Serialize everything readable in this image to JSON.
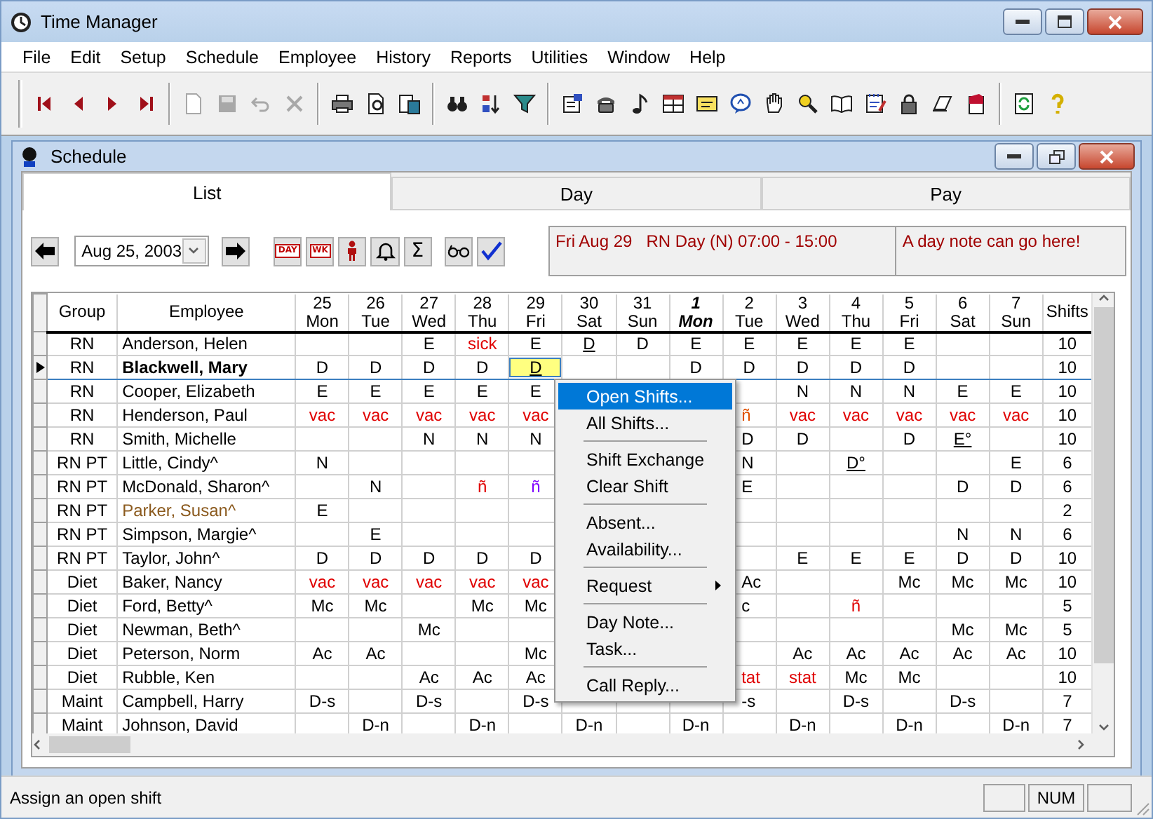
{
  "window": {
    "title": "Time Manager"
  },
  "menu": [
    "File",
    "Edit",
    "Setup",
    "Schedule",
    "Employee",
    "History",
    "Reports",
    "Utilities",
    "Window",
    "Help"
  ],
  "toolbar": [
    [
      {
        "disabled": false
      },
      {
        "disabled": false
      },
      {
        "disabled": false
      },
      {
        "disabled": false
      }
    ],
    [
      {
        "disabled": true
      },
      {
        "disabled": true
      },
      {
        "disabled": true
      },
      {
        "disabled": true
      }
    ],
    [
      {
        "disabled": false
      },
      {
        "disabled": false
      },
      {
        "disabled": false
      }
    ],
    [
      {
        "disabled": false
      },
      {
        "disabled": false
      },
      {
        "disabled": false
      }
    ],
    [
      {
        "disabled": false
      },
      {
        "disabled": false
      },
      {
        "disabled": false
      },
      {
        "disabled": false
      },
      {
        "disabled": false
      },
      {
        "disabled": false
      },
      {
        "disabled": false
      },
      {
        "disabled": false
      },
      {
        "disabled": false
      },
      {
        "disabled": false
      },
      {
        "disabled": false
      },
      {
        "disabled": false
      },
      {
        "disabled": false
      }
    ],
    [
      {
        "disabled": false
      },
      {
        "disabled": false
      }
    ]
  ],
  "schedule": {
    "title": "Schedule",
    "tabs": [
      {
        "label": "List",
        "selected": true
      },
      {
        "label": "Day",
        "selected": false
      },
      {
        "label": "Pay",
        "selected": false
      }
    ],
    "date": "Aug 25, 2003",
    "day_label": "DAY",
    "week_label": "WK",
    "sum_label": "Σ",
    "shift_info": "Fri Aug 29   RN Day (N) 07:00 - 15:00",
    "day_note": "A day note can go here!",
    "columns": {
      "group": "Group",
      "employee": "Employee",
      "shifts": "Shifts",
      "days": [
        {
          "date": "25",
          "weekday": "Mon",
          "emphasized": false
        },
        {
          "date": "26",
          "weekday": "Tue",
          "emphasized": false
        },
        {
          "date": "27",
          "weekday": "Wed",
          "emphasized": false
        },
        {
          "date": "28",
          "weekday": "Thu",
          "emphasized": false
        },
        {
          "date": "29",
          "weekday": "Fri",
          "emphasized": false
        },
        {
          "date": "30",
          "weekday": "Sat",
          "emphasized": false
        },
        {
          "date": "31",
          "weekday": "Sun",
          "emphasized": false
        },
        {
          "date": "1",
          "weekday": "Mon",
          "emphasized": true
        },
        {
          "date": "2",
          "weekday": "Tue",
          "emphasized": false
        },
        {
          "date": "3",
          "weekday": "Wed",
          "emphasized": false
        },
        {
          "date": "4",
          "weekday": "Thu",
          "emphasized": false
        },
        {
          "date": "5",
          "weekday": "Fri",
          "emphasized": false
        },
        {
          "date": "6",
          "weekday": "Sat",
          "emphasized": false
        },
        {
          "date": "7",
          "weekday": "Sun",
          "emphasized": false
        }
      ]
    },
    "rows": [
      {
        "group": "RN",
        "name": "Anderson, Helen",
        "color": "#000000",
        "selected": false,
        "shifts": "10",
        "days": [
          {
            "kind": "blank"
          },
          {
            "kind": "blank"
          },
          {
            "kind": "shift",
            "text": "E"
          },
          {
            "kind": "shift",
            "text": "sick",
            "color": "#e00000"
          },
          {
            "kind": "shift",
            "text": "E"
          },
          {
            "kind": "shift",
            "text": "D",
            "underlined": true
          },
          {
            "kind": "shift",
            "text": "D"
          },
          {
            "kind": "shift",
            "text": "E"
          },
          {
            "kind": "shift",
            "text": "E"
          },
          {
            "kind": "shift",
            "text": "E"
          },
          {
            "kind": "shift",
            "text": "E"
          },
          {
            "kind": "shift",
            "text": "E"
          },
          {
            "kind": "blank"
          },
          {
            "kind": "blank"
          }
        ]
      },
      {
        "group": "RN",
        "name": "Blackwell, Mary",
        "color": "#000000",
        "selected": true,
        "shifts": "10",
        "days": [
          {
            "kind": "shift",
            "text": "D"
          },
          {
            "kind": "shift",
            "text": "D"
          },
          {
            "kind": "shift",
            "text": "D"
          },
          {
            "kind": "shift",
            "text": "D"
          },
          {
            "kind": "shift",
            "text": "D",
            "underlined": true,
            "focused": true
          },
          {
            "kind": "blank"
          },
          {
            "kind": "blank"
          },
          {
            "kind": "shift",
            "text": "D"
          },
          {
            "kind": "shift",
            "text": "D"
          },
          {
            "kind": "shift",
            "text": "D"
          },
          {
            "kind": "shift",
            "text": "D"
          },
          {
            "kind": "shift",
            "text": "D"
          },
          {
            "kind": "blank"
          },
          {
            "kind": "blank"
          }
        ]
      },
      {
        "group": "RN",
        "name": "Cooper, Elizabeth",
        "color": "#000000",
        "selected": false,
        "shifts": "10",
        "days": [
          {
            "kind": "shift",
            "text": "E"
          },
          {
            "kind": "shift",
            "text": "E"
          },
          {
            "kind": "shift",
            "text": "E"
          },
          {
            "kind": "shift",
            "text": "E"
          },
          {
            "kind": "shift",
            "text": "E"
          },
          {
            "kind": "blank"
          },
          {
            "kind": "blank"
          },
          {
            "kind": "blank"
          },
          {
            "kind": "blank"
          },
          {
            "kind": "shift",
            "text": "N"
          },
          {
            "kind": "shift",
            "text": "N"
          },
          {
            "kind": "shift",
            "text": "N"
          },
          {
            "kind": "shift",
            "text": "E"
          },
          {
            "kind": "shift",
            "text": "E"
          }
        ]
      },
      {
        "group": "RN",
        "name": "Henderson, Paul",
        "color": "#000000",
        "selected": false,
        "shifts": "10",
        "days": [
          {
            "kind": "shift",
            "text": "vac",
            "color": "#e00000"
          },
          {
            "kind": "shift",
            "text": "vac",
            "color": "#e00000"
          },
          {
            "kind": "shift",
            "text": "vac",
            "color": "#e00000"
          },
          {
            "kind": "shift",
            "text": "vac",
            "color": "#e00000"
          },
          {
            "kind": "shift",
            "text": "vac",
            "color": "#e00000"
          },
          {
            "kind": "blank"
          },
          {
            "kind": "blank"
          },
          {
            "kind": "blank"
          },
          {
            "kind": "partial",
            "text": "ñ",
            "color": "#e05000"
          },
          {
            "kind": "shift",
            "text": "vac",
            "color": "#e00000"
          },
          {
            "kind": "shift",
            "text": "vac",
            "color": "#e00000"
          },
          {
            "kind": "shift",
            "text": "vac",
            "color": "#e00000"
          },
          {
            "kind": "shift",
            "text": "vac",
            "color": "#e00000"
          },
          {
            "kind": "shift",
            "text": "vac",
            "color": "#e00000"
          }
        ]
      },
      {
        "group": "RN",
        "name": "Smith, Michelle",
        "color": "#000000",
        "selected": false,
        "shifts": "10",
        "days": [
          {
            "kind": "blank"
          },
          {
            "kind": "blank"
          },
          {
            "kind": "shift",
            "text": "N"
          },
          {
            "kind": "shift",
            "text": "N"
          },
          {
            "kind": "shift",
            "text": "N"
          },
          {
            "kind": "blank"
          },
          {
            "kind": "blank"
          },
          {
            "kind": "blank"
          },
          {
            "kind": "partial",
            "text": "D"
          },
          {
            "kind": "shift",
            "text": "D"
          },
          {
            "kind": "blank"
          },
          {
            "kind": "shift",
            "text": "D"
          },
          {
            "kind": "shift",
            "text": "E°",
            "underlined": true
          },
          {
            "kind": "blank"
          }
        ]
      },
      {
        "group": "RN PT",
        "name": "Little, Cindy^",
        "color": "#000000",
        "selected": false,
        "shifts": "6",
        "days": [
          {
            "kind": "shift",
            "text": "N"
          },
          {
            "kind": "blank"
          },
          {
            "kind": "blank"
          },
          {
            "kind": "blank"
          },
          {
            "kind": "blank"
          },
          {
            "kind": "blank"
          },
          {
            "kind": "blank"
          },
          {
            "kind": "blank"
          },
          {
            "kind": "partial",
            "text": "N"
          },
          {
            "kind": "blank"
          },
          {
            "kind": "shift",
            "text": "D°",
            "underlined": true
          },
          {
            "kind": "blank"
          },
          {
            "kind": "blank"
          },
          {
            "kind": "shift",
            "text": "E"
          }
        ]
      },
      {
        "group": "RN PT",
        "name": "McDonald, Sharon^",
        "color": "#000000",
        "selected": false,
        "shifts": "6",
        "days": [
          {
            "kind": "blank"
          },
          {
            "kind": "shift",
            "text": "N"
          },
          {
            "kind": "blank"
          },
          {
            "kind": "shift",
            "text": "ñ",
            "color": "#e00000"
          },
          {
            "kind": "shift",
            "text": "ñ",
            "color": "#8000ff"
          },
          {
            "kind": "blank"
          },
          {
            "kind": "blank"
          },
          {
            "kind": "blank"
          },
          {
            "kind": "partial",
            "text": "E"
          },
          {
            "kind": "blank"
          },
          {
            "kind": "blank"
          },
          {
            "kind": "blank"
          },
          {
            "kind": "shift",
            "text": "D"
          },
          {
            "kind": "shift",
            "text": "D"
          }
        ]
      },
      {
        "group": "RN PT",
        "name": "Parker, Susan^",
        "color": "#8b5a1e",
        "selected": false,
        "shifts": "2",
        "days": [
          {
            "kind": "shift",
            "text": "E"
          },
          {
            "kind": "blank"
          },
          {
            "kind": "blank"
          },
          {
            "kind": "blank"
          },
          {
            "kind": "blank"
          },
          {
            "kind": "blank"
          },
          {
            "kind": "blank"
          },
          {
            "kind": "blank"
          },
          {
            "kind": "blank"
          },
          {
            "kind": "blank"
          },
          {
            "kind": "blank"
          },
          {
            "kind": "blank"
          },
          {
            "kind": "blank"
          },
          {
            "kind": "blank"
          }
        ]
      },
      {
        "group": "RN PT",
        "name": "Simpson, Margie^",
        "color": "#000000",
        "selected": false,
        "shifts": "6",
        "days": [
          {
            "kind": "blank"
          },
          {
            "kind": "shift",
            "text": "E"
          },
          {
            "kind": "blank"
          },
          {
            "kind": "blank"
          },
          {
            "kind": "blank"
          },
          {
            "kind": "blank"
          },
          {
            "kind": "blank"
          },
          {
            "kind": "blank"
          },
          {
            "kind": "blank"
          },
          {
            "kind": "blank"
          },
          {
            "kind": "blank"
          },
          {
            "kind": "blank"
          },
          {
            "kind": "shift",
            "text": "N"
          },
          {
            "kind": "shift",
            "text": "N"
          }
        ]
      },
      {
        "group": "RN PT",
        "name": "Taylor, John^",
        "color": "#000000",
        "selected": false,
        "shifts": "10",
        "days": [
          {
            "kind": "shift",
            "text": "D"
          },
          {
            "kind": "shift",
            "text": "D"
          },
          {
            "kind": "shift",
            "text": "D"
          },
          {
            "kind": "shift",
            "text": "D"
          },
          {
            "kind": "shift",
            "text": "D"
          },
          {
            "kind": "blank"
          },
          {
            "kind": "blank"
          },
          {
            "kind": "blank"
          },
          {
            "kind": "blank"
          },
          {
            "kind": "shift",
            "text": "E"
          },
          {
            "kind": "shift",
            "text": "E"
          },
          {
            "kind": "shift",
            "text": "E"
          },
          {
            "kind": "shift",
            "text": "D"
          },
          {
            "kind": "shift",
            "text": "D"
          }
        ]
      },
      {
        "group": "Diet",
        "name": "Baker, Nancy",
        "color": "#000000",
        "selected": false,
        "shifts": "10",
        "days": [
          {
            "kind": "shift",
            "text": "vac",
            "color": "#e00000"
          },
          {
            "kind": "shift",
            "text": "vac",
            "color": "#e00000"
          },
          {
            "kind": "shift",
            "text": "vac",
            "color": "#e00000"
          },
          {
            "kind": "shift",
            "text": "vac",
            "color": "#e00000"
          },
          {
            "kind": "shift",
            "text": "vac",
            "color": "#e00000"
          },
          {
            "kind": "blank"
          },
          {
            "kind": "blank"
          },
          {
            "kind": "blank"
          },
          {
            "kind": "partial",
            "text": "Ac"
          },
          {
            "kind": "blank"
          },
          {
            "kind": "blank"
          },
          {
            "kind": "shift",
            "text": "Mc"
          },
          {
            "kind": "shift",
            "text": "Mc"
          },
          {
            "kind": "shift",
            "text": "Mc"
          }
        ]
      },
      {
        "group": "Diet",
        "name": "Ford, Betty^",
        "color": "#000000",
        "selected": false,
        "shifts": "5",
        "days": [
          {
            "kind": "shift",
            "text": "Mc"
          },
          {
            "kind": "shift",
            "text": "Mc"
          },
          {
            "kind": "blank"
          },
          {
            "kind": "shift",
            "text": "Mc"
          },
          {
            "kind": "shift",
            "text": "Mc"
          },
          {
            "kind": "blank"
          },
          {
            "kind": "blank"
          },
          {
            "kind": "blank"
          },
          {
            "kind": "partial",
            "text": "c"
          },
          {
            "kind": "blank"
          },
          {
            "kind": "shift",
            "text": "ñ",
            "color": "#e00000"
          },
          {
            "kind": "blank"
          },
          {
            "kind": "blank"
          },
          {
            "kind": "blank"
          }
        ]
      },
      {
        "group": "Diet",
        "name": "Newman, Beth^",
        "color": "#000000",
        "selected": false,
        "shifts": "5",
        "days": [
          {
            "kind": "blank"
          },
          {
            "kind": "blank"
          },
          {
            "kind": "shift",
            "text": "Mc"
          },
          {
            "kind": "blank"
          },
          {
            "kind": "blank"
          },
          {
            "kind": "blank"
          },
          {
            "kind": "blank"
          },
          {
            "kind": "blank"
          },
          {
            "kind": "blank"
          },
          {
            "kind": "blank"
          },
          {
            "kind": "blank"
          },
          {
            "kind": "blank"
          },
          {
            "kind": "shift",
            "text": "Mc"
          },
          {
            "kind": "shift",
            "text": "Mc"
          }
        ]
      },
      {
        "group": "Diet",
        "name": "Peterson, Norm",
        "color": "#000000",
        "selected": false,
        "shifts": "10",
        "days": [
          {
            "kind": "shift",
            "text": "Ac"
          },
          {
            "kind": "shift",
            "text": "Ac"
          },
          {
            "kind": "blank"
          },
          {
            "kind": "blank"
          },
          {
            "kind": "shift",
            "text": "Mc"
          },
          {
            "kind": "blank"
          },
          {
            "kind": "blank"
          },
          {
            "kind": "blank"
          },
          {
            "kind": "blank"
          },
          {
            "kind": "shift",
            "text": "Ac"
          },
          {
            "kind": "shift",
            "text": "Ac"
          },
          {
            "kind": "shift",
            "text": "Ac"
          },
          {
            "kind": "shift",
            "text": "Ac"
          },
          {
            "kind": "shift",
            "text": "Ac"
          }
        ]
      },
      {
        "group": "Diet",
        "name": "Rubble, Ken",
        "color": "#000000",
        "selected": false,
        "shifts": "10",
        "days": [
          {
            "kind": "blank"
          },
          {
            "kind": "blank"
          },
          {
            "kind": "shift",
            "text": "Ac"
          },
          {
            "kind": "shift",
            "text": "Ac"
          },
          {
            "kind": "shift",
            "text": "Ac"
          },
          {
            "kind": "blank"
          },
          {
            "kind": "blank"
          },
          {
            "kind": "blank"
          },
          {
            "kind": "partial",
            "text": "tat",
            "color": "#e00000"
          },
          {
            "kind": "shift",
            "text": "stat",
            "color": "#e00000"
          },
          {
            "kind": "shift",
            "text": "Mc"
          },
          {
            "kind": "shift",
            "text": "Mc"
          },
          {
            "kind": "blank"
          },
          {
            "kind": "blank"
          }
        ]
      },
      {
        "group": "Maint",
        "name": "Campbell, Harry",
        "color": "#000000",
        "selected": false,
        "shifts": "7",
        "days": [
          {
            "kind": "shift",
            "text": "D-s"
          },
          {
            "kind": "blank"
          },
          {
            "kind": "shift",
            "text": "D-s"
          },
          {
            "kind": "blank"
          },
          {
            "kind": "shift",
            "text": "D-s"
          },
          {
            "kind": "blank"
          },
          {
            "kind": "blank"
          },
          {
            "kind": "blank"
          },
          {
            "kind": "partial",
            "text": "-s"
          },
          {
            "kind": "blank"
          },
          {
            "kind": "shift",
            "text": "D-s"
          },
          {
            "kind": "blank"
          },
          {
            "kind": "shift",
            "text": "D-s"
          },
          {
            "kind": "blank"
          }
        ]
      },
      {
        "group": "Maint",
        "name": "Johnson, David",
        "color": "#000000",
        "selected": false,
        "shifts": "7",
        "days": [
          {
            "kind": "blank"
          },
          {
            "kind": "shift",
            "text": "D-n"
          },
          {
            "kind": "blank"
          },
          {
            "kind": "shift",
            "text": "D-n"
          },
          {
            "kind": "blank"
          },
          {
            "kind": "shift",
            "text": "D-n"
          },
          {
            "kind": "blank"
          },
          {
            "kind": "shift",
            "text": "D-n"
          },
          {
            "kind": "blank"
          },
          {
            "kind": "shift",
            "text": "D-n"
          },
          {
            "kind": "blank"
          },
          {
            "kind": "shift",
            "text": "D-n"
          },
          {
            "kind": "blank"
          },
          {
            "kind": "shift",
            "text": "D-n"
          }
        ]
      }
    ],
    "context_menu": [
      {
        "kind": "item",
        "label": "Open Shifts...",
        "selected": true
      },
      {
        "kind": "item",
        "label": "All Shifts...",
        "selected": false
      },
      {
        "kind": "separator"
      },
      {
        "kind": "item",
        "label": "Shift Exchange",
        "selected": false
      },
      {
        "kind": "item",
        "label": "Clear Shift",
        "selected": false
      },
      {
        "kind": "separator"
      },
      {
        "kind": "item",
        "label": "Absent...",
        "selected": false
      },
      {
        "kind": "item",
        "label": "Availability...",
        "selected": false
      },
      {
        "kind": "separator"
      },
      {
        "kind": "submenu",
        "label": "Request",
        "selected": false
      },
      {
        "kind": "separator"
      },
      {
        "kind": "item",
        "label": "Day Note...",
        "selected": false
      },
      {
        "kind": "item",
        "label": "Task...",
        "selected": false
      },
      {
        "kind": "separator"
      },
      {
        "kind": "item",
        "label": "Call Reply...",
        "selected": false
      }
    ]
  },
  "status_bar": {
    "message": "Assign an open shift",
    "indicators": [
      "NUM"
    ]
  }
}
